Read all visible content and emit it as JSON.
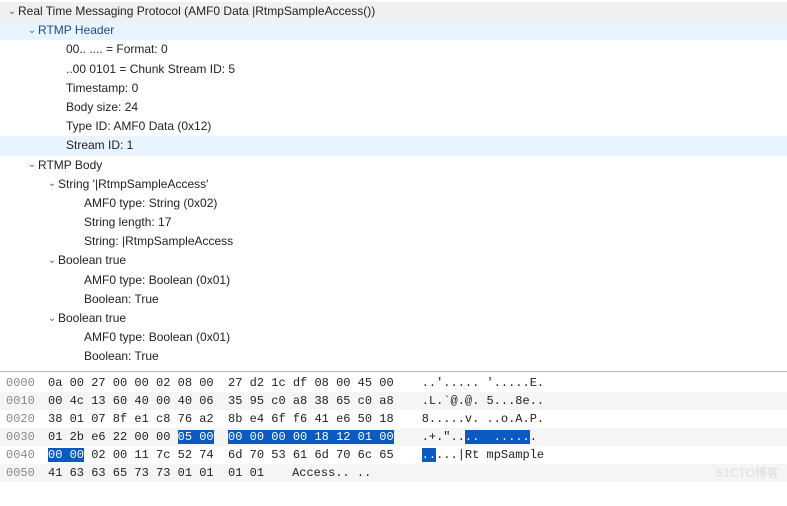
{
  "tree": {
    "title": "Real Time Messaging Protocol (AMF0 Data |RtmpSampleAccess())",
    "header": {
      "label": "RTMP Header",
      "format": "00.. .... = Format: 0",
      "chunk": "..00 0101 = Chunk Stream ID: 5",
      "timestamp": "Timestamp: 0",
      "bodysize": "Body size: 24",
      "typeid": "Type ID: AMF0 Data (0x12)",
      "streamid": "Stream ID: 1"
    },
    "body": {
      "label": "RTMP Body",
      "str": {
        "label": "String '|RtmpSampleAccess'",
        "type": "AMF0 type: String (0x02)",
        "len": "String length: 17",
        "val": "String: |RtmpSampleAccess"
      },
      "bool1": {
        "label": "Boolean true",
        "type": "AMF0 type: Boolean (0x01)",
        "val": "Boolean: True"
      },
      "bool2": {
        "label": "Boolean true",
        "type": "AMF0 type: Boolean (0x01)",
        "val": "Boolean: True"
      }
    }
  },
  "hex": {
    "rows": [
      {
        "off": "0000",
        "b1": "0a 00 27 00 00 02 08 00",
        "b2": "27 d2 1c df 08 00 45 00",
        "ascii": "..'..... '.....E."
      },
      {
        "off": "0010",
        "b1": "00 4c 13 60 40 00 40 06",
        "b2": "35 95 c0 a8 38 65 c0 a8",
        "ascii": ".L.`@.@. 5...8e.."
      },
      {
        "off": "0020",
        "b1": "38 01 07 8f e1 c8 76 a2",
        "b2": "8b e4 6f f6 41 e6 50 18",
        "ascii": "8.....v. ..o.A.P."
      },
      {
        "off": "0030",
        "b1": "01 2b e6 22 00 00 ",
        "sel1": "05 00",
        "selgap": "  ",
        "sel2": "00 00 00 00 18 12 01 00",
        "ascii1": ".+.\"..",
        "ascsel": "..  .....",
        "ascii2": "."
      },
      {
        "off": "0040",
        "sel3": "00 00",
        "b3": " 02 00 11 7c 52 74",
        "b4": "6d 70 53 61 6d 70 6c 65",
        "ascsel2": "..",
        "ascii3": "...|Rt mpSample"
      },
      {
        "off": "0050",
        "b1": "41 63 63 65 73 73 01 01",
        "b2": "01 01",
        "ascii": "Access.. .."
      }
    ]
  },
  "watermark": "51CTO博客"
}
